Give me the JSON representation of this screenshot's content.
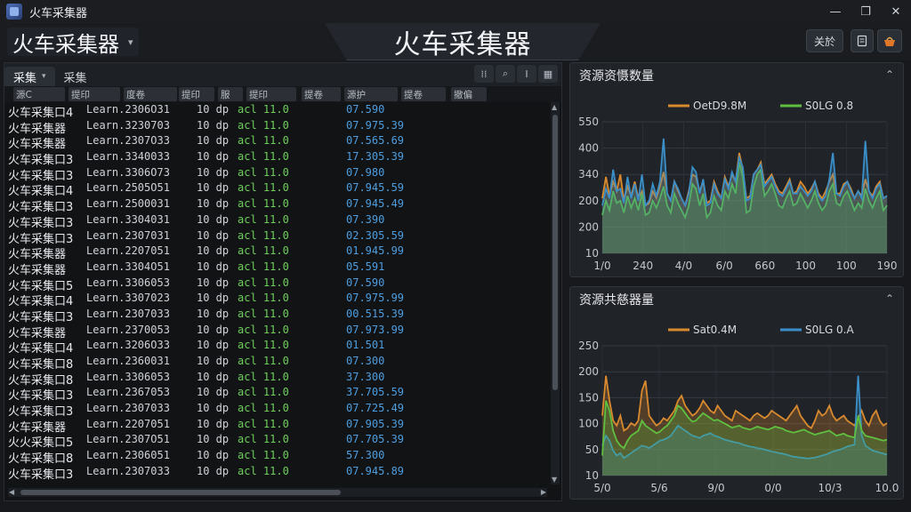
{
  "window": {
    "title": "火车采集器",
    "controls": {
      "minimize": "—",
      "maximize": "❐",
      "close": "✕"
    }
  },
  "header": {
    "app_selector_label": "火车采集器",
    "title": "火车采集器",
    "button_1": "关於",
    "icons": [
      "document-icon",
      "basket-icon"
    ]
  },
  "left_panel": {
    "tabs": [
      {
        "label": "采集",
        "has_dropdown": true,
        "active": true
      },
      {
        "label": "采集",
        "has_dropdown": false,
        "active": false
      }
    ],
    "toolbar_icons": [
      "columns-icon",
      "search-icon",
      "text-cursor-icon",
      "grid-icon"
    ],
    "columns": [
      "源C",
      "提印",
      "度卷",
      "提印",
      "服",
      "提印",
      "提卷",
      "源护",
      "提卷",
      "撤偏"
    ],
    "rows": [
      {
        "name": "火车采集口4",
        "meta": "Learn.2306O31",
        "code": "10 dp",
        "status": "acl 11.0",
        "value": "07.590"
      },
      {
        "name": "火车采集器",
        "meta": "Learn.3230703",
        "code": "10 dp",
        "status": "acl 11.0",
        "value": "07.975.39"
      },
      {
        "name": "火车采集器",
        "meta": "Learn.2307O33",
        "code": "10 dp",
        "status": "acl 11.0",
        "value": "07.565.69"
      },
      {
        "name": "火车采集口3",
        "meta": "Learn.3340033",
        "code": "10 dp",
        "status": "acl 11.0",
        "value": "17.305.39"
      },
      {
        "name": "火车采集口3",
        "meta": "Learn.3306O73",
        "code": "10 dp",
        "status": "acl 11.0",
        "value": "07.980"
      },
      {
        "name": "火车采集口4",
        "meta": "Learn.2505O51",
        "code": "10 dp",
        "status": "acl 11.0",
        "value": "07.945.59"
      },
      {
        "name": "火车采集口3",
        "meta": "Learn.2500031",
        "code": "10 dp",
        "status": "acl 11.0",
        "value": "07.945.49"
      },
      {
        "name": "火车采集口3",
        "meta": "Learn.3304031",
        "code": "10 dp",
        "status": "acl 11.0",
        "value": "07.390"
      },
      {
        "name": "火车采集口3",
        "meta": "Learn.2307031",
        "code": "10 dp",
        "status": "acl 11.0",
        "value": "02.305.59"
      },
      {
        "name": "火车采集器",
        "meta": "Learn.2207051",
        "code": "10 dp",
        "status": "acl 11.0",
        "value": "01.945.99"
      },
      {
        "name": "火车采集器",
        "meta": "Learn.3304O51",
        "code": "10 dp",
        "status": "acl 11.0",
        "value": "05.591"
      },
      {
        "name": "火车采集口5",
        "meta": "Learn.3306053",
        "code": "10 dp",
        "status": "acl 11.0",
        "value": "07.590"
      },
      {
        "name": "火车采集口4",
        "meta": "Learn.3307023",
        "code": "10 dp",
        "status": "acl 11.0",
        "value": "07.975.99"
      },
      {
        "name": "火车采集口3",
        "meta": "Learn.2307033",
        "code": "10 dp",
        "status": "acl 11.0",
        "value": "00.515.39"
      },
      {
        "name": "火车采集器",
        "meta": "Learn.2370053",
        "code": "10 dp",
        "status": "acl 11.0",
        "value": "07.973.99"
      },
      {
        "name": "火车采集口4",
        "meta": "Learn.3206O33",
        "code": "10 dp",
        "status": "acl 11.0",
        "value": "01.501"
      },
      {
        "name": "火车采集口8",
        "meta": "Learn.2360031",
        "code": "10 dp",
        "status": "acl 11.0",
        "value": "07.300"
      },
      {
        "name": "火车采集口8",
        "meta": "Learn.3306053",
        "code": "10 dp",
        "status": "acl 11.0",
        "value": "37.300"
      },
      {
        "name": "火车采集口3",
        "meta": "Learn.2367053",
        "code": "10 dp",
        "status": "acl 11.0",
        "value": "37.705.59"
      },
      {
        "name": "火车采集口3",
        "meta": "Learn.2307033",
        "code": "10 dp",
        "status": "acl 11.0",
        "value": "07.725.49"
      },
      {
        "name": "火车采集器",
        "meta": "Learn.2207051",
        "code": "10 dp",
        "status": "acl 11.0",
        "value": "07.905.39"
      },
      {
        "name": "火火采集口5",
        "meta": "Learn.2307O51",
        "code": "10 dp",
        "status": "acl 11.0",
        "value": "07.705.39"
      },
      {
        "name": "火车采集口8",
        "meta": "Learn.2306051",
        "code": "10 dp",
        "status": "acl 11.0",
        "value": "57.300"
      },
      {
        "name": "火车采集口3",
        "meta": "Learn.2307033",
        "code": "10 dp",
        "status": "acl 11.0",
        "value": "07.945.89"
      }
    ]
  },
  "chart_data": [
    {
      "type": "line",
      "title": "资源资慑数量",
      "legend_placement": "top",
      "x_tick_labels": [
        "1/0",
        "240",
        "4/0",
        "6/0",
        "660",
        "100",
        "100",
        "190"
      ],
      "y_tick_labels": [
        "10",
        "200",
        "200",
        "340",
        "400",
        "550"
      ],
      "ylim": [
        0,
        550
      ],
      "grid": true,
      "series": [
        {
          "name": "OetD9.8M",
          "color": "#d98a2e",
          "values": [
            230,
            320,
            240,
            300,
            260,
            330,
            220,
            280,
            240,
            300,
            230,
            260,
            200,
            210,
            260,
            230,
            280,
            340,
            250,
            220,
            300,
            260,
            230,
            200,
            260,
            330,
            320,
            260,
            300,
            210,
            220,
            300,
            260,
            230,
            320,
            280,
            330,
            300,
            420,
            350,
            230,
            240,
            330,
            350,
            380,
            290,
            310,
            330,
            290,
            260,
            250,
            280,
            310,
            250,
            260,
            300,
            280,
            250,
            270,
            300,
            250,
            230,
            260,
            300,
            330,
            250,
            250,
            290,
            300,
            270,
            230,
            260,
            240,
            310,
            260,
            240,
            280,
            300,
            230,
            240
          ]
        },
        {
          "name": "S0LG 0.8",
          "color": "#5fbf3f",
          "values": [
            160,
            220,
            180,
            260,
            210,
            220,
            170,
            240,
            190,
            230,
            180,
            250,
            160,
            170,
            220,
            190,
            230,
            280,
            200,
            170,
            250,
            210,
            180,
            150,
            200,
            290,
            270,
            200,
            250,
            150,
            170,
            240,
            200,
            180,
            260,
            230,
            290,
            250,
            380,
            320,
            170,
            180,
            280,
            330,
            350,
            240,
            260,
            290,
            250,
            200,
            190,
            230,
            260,
            200,
            210,
            250,
            220,
            190,
            220,
            260,
            210,
            180,
            200,
            260,
            290,
            210,
            200,
            240,
            260,
            220,
            180,
            210,
            190,
            270,
            220,
            190,
            230,
            260,
            180,
            200
          ]
        },
        {
          "name": "",
          "color": "#3b8fc9",
          "values": [
            200,
            270,
            230,
            350,
            260,
            270,
            210,
            320,
            230,
            290,
            220,
            330,
            200,
            220,
            290,
            240,
            300,
            480,
            250,
            220,
            300,
            270,
            230,
            200,
            250,
            360,
            340,
            250,
            310,
            200,
            210,
            290,
            250,
            230,
            310,
            270,
            340,
            300,
            400,
            360,
            220,
            230,
            330,
            350,
            370,
            280,
            300,
            320,
            280,
            250,
            240,
            270,
            300,
            250,
            250,
            280,
            260,
            240,
            260,
            300,
            240,
            220,
            240,
            310,
            420,
            250,
            240,
            280,
            300,
            260,
            230,
            260,
            230,
            470,
            260,
            230,
            270,
            290,
            230,
            240
          ]
        }
      ]
    },
    {
      "type": "line",
      "title": "资源共慈器量",
      "legend_placement": "top",
      "x_tick_labels": [
        "5/0",
        "5/6",
        "9/0",
        "0/0",
        "10/3",
        "10.0"
      ],
      "y_tick_labels": [
        "10",
        "50",
        "100",
        "150",
        "200",
        "250"
      ],
      "ylim": [
        0,
        260
      ],
      "grid": true,
      "series": [
        {
          "name": "Sat0.4M",
          "color": "#d98a2e",
          "values": [
            120,
            200,
            150,
            110,
            100,
            120,
            90,
            95,
            105,
            100,
            110,
            170,
            190,
            120,
            110,
            100,
            105,
            115,
            110,
            120,
            130,
            150,
            160,
            140,
            130,
            120,
            125,
            135,
            150,
            140,
            130,
            125,
            140,
            130,
            120,
            115,
            110,
            130,
            125,
            120,
            115,
            110,
            120,
            125,
            120,
            115,
            120,
            130,
            125,
            120,
            115,
            110,
            120,
            130,
            140,
            120,
            110,
            100,
            95,
            110,
            130,
            120,
            125,
            140,
            120,
            110,
            115,
            120,
            110,
            105,
            100,
            115,
            130,
            110,
            100,
            120,
            130,
            110,
            100,
            105
          ]
        },
        {
          "name": "S0LG 0.A",
          "color": "#3b8fc9",
          "values": [
            60,
            80,
            70,
            50,
            40,
            45,
            35,
            40,
            45,
            50,
            55,
            60,
            58,
            55,
            60,
            65,
            70,
            72,
            75,
            80,
            90,
            100,
            95,
            90,
            85,
            80,
            78,
            75,
            80,
            82,
            85,
            80,
            78,
            75,
            72,
            70,
            68,
            66,
            65,
            62,
            60,
            58,
            57,
            55,
            54,
            52,
            50,
            48,
            47,
            45,
            44,
            42,
            40,
            38,
            37,
            36,
            35,
            34,
            35,
            36,
            38,
            40,
            42,
            45,
            48,
            50,
            52,
            55,
            58,
            60,
            62,
            200,
            80,
            60,
            55,
            50,
            48,
            46,
            44,
            42
          ]
        },
        {
          "name": "",
          "color": "#5fbf3f",
          "values": [
            40,
            150,
            130,
            90,
            70,
            60,
            55,
            70,
            80,
            85,
            90,
            110,
            100,
            95,
            90,
            85,
            88,
            95,
            100,
            110,
            120,
            140,
            135,
            125,
            115,
            108,
            110,
            118,
            125,
            120,
            115,
            110,
            112,
            108,
            104,
            100,
            96,
            98,
            100,
            96,
            94,
            92,
            95,
            98,
            96,
            94,
            92,
            95,
            98,
            96,
            94,
            90,
            88,
            86,
            88,
            90,
            92,
            88,
            85,
            82,
            84,
            86,
            88,
            90,
            85,
            80,
            82,
            84,
            80,
            78,
            76,
            120,
            90,
            80,
            78,
            76,
            74,
            72,
            70,
            72
          ]
        }
      ]
    }
  ]
}
